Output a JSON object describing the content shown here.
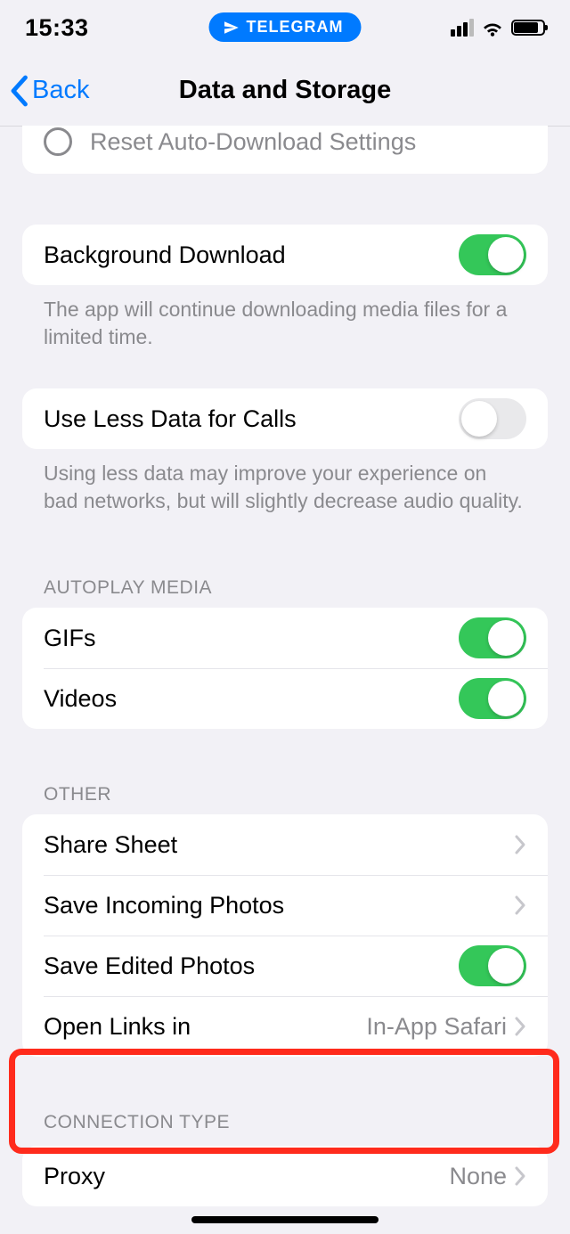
{
  "status": {
    "time": "15:33",
    "pill_app": "TELEGRAM"
  },
  "nav": {
    "back_label": "Back",
    "title": "Data and Storage"
  },
  "reset_row": {
    "label": "Reset Auto-Download Settings"
  },
  "background_download": {
    "label": "Background Download",
    "footer": "The app will continue downloading media files for a limited time.",
    "on": true
  },
  "use_less_data": {
    "label": "Use Less Data for Calls",
    "footer": "Using less data may improve your experience on bad networks, but will slightly decrease audio quality.",
    "on": false
  },
  "autoplay": {
    "header": "AUTOPLAY MEDIA",
    "gifs": {
      "label": "GIFs",
      "on": true
    },
    "videos": {
      "label": "Videos",
      "on": true
    }
  },
  "other": {
    "header": "OTHER",
    "share_sheet": {
      "label": "Share Sheet"
    },
    "save_incoming": {
      "label": "Save Incoming Photos"
    },
    "save_edited": {
      "label": "Save Edited Photos",
      "on": true
    },
    "open_links": {
      "label": "Open Links in",
      "value": "In-App Safari"
    }
  },
  "connection": {
    "header": "CONNECTION TYPE",
    "proxy": {
      "label": "Proxy",
      "value": "None"
    }
  }
}
